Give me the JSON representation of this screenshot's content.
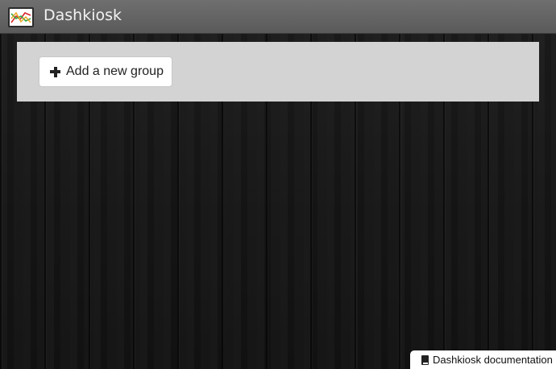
{
  "navbar": {
    "title": "Dashkiosk",
    "logo_icon": "dashkiosk-logo-icon"
  },
  "groups_panel": {
    "add_group_label": "Add a new group",
    "add_group_icon": "plus-icon"
  },
  "footer": {
    "doc_link_label": "Dashkiosk documentation",
    "doc_link_icon": "book-icon"
  },
  "colors": {
    "navbar_bg": "#666666",
    "panel_bg": "#d3d3d3",
    "page_bg": "#151515"
  }
}
